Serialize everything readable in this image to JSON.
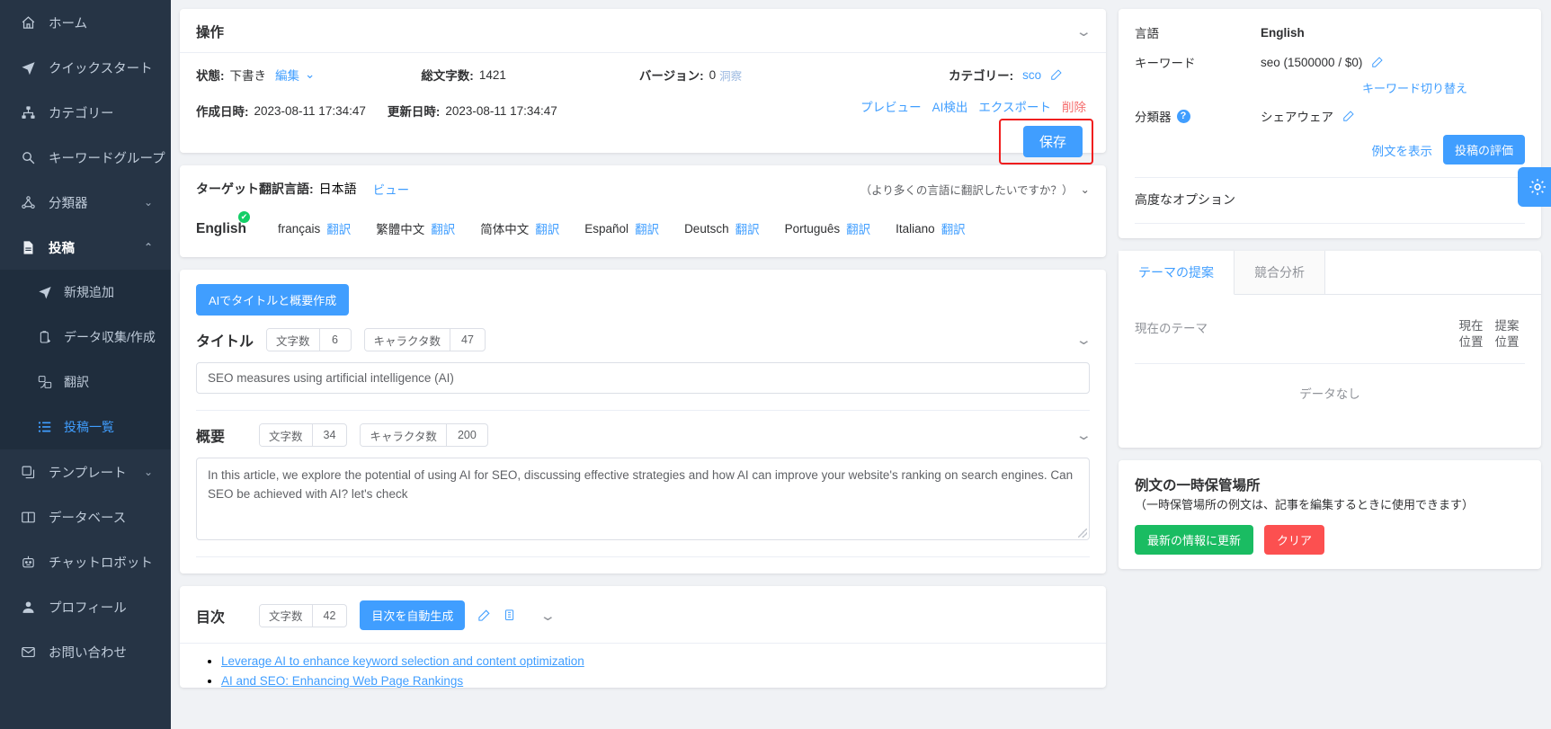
{
  "sidebar": {
    "items": [
      {
        "label": "ホーム",
        "icon": "home-icon",
        "caret": false
      },
      {
        "label": "クイックスタート",
        "icon": "rocket-icon",
        "caret": false
      },
      {
        "label": "カテゴリー",
        "icon": "sitemap-icon",
        "caret": false
      },
      {
        "label": "キーワードグループ",
        "icon": "search-icon",
        "caret": true
      },
      {
        "label": "分類器",
        "icon": "share-nodes-icon",
        "caret": true
      },
      {
        "label": "投稿",
        "icon": "document-icon",
        "caret": true,
        "expanded": true
      }
    ],
    "sub_items": [
      {
        "label": "新規追加",
        "icon": "send-icon",
        "active": false
      },
      {
        "label": "データ収集/作成",
        "icon": "clipboard-plus-icon",
        "active": false
      },
      {
        "label": "翻訳",
        "icon": "translate-icon",
        "active": false
      },
      {
        "label": "投稿一覧",
        "icon": "list-icon",
        "active": true
      }
    ],
    "items_after": [
      {
        "label": "テンプレート",
        "icon": "copy-icon",
        "caret": true
      },
      {
        "label": "データベース",
        "icon": "database-icon",
        "caret": false
      },
      {
        "label": "チャットロボット",
        "icon": "robot-icon",
        "caret": false
      },
      {
        "label": "プロフィール",
        "icon": "user-icon",
        "caret": false
      },
      {
        "label": "お問い合わせ",
        "icon": "mail-icon",
        "caret": false
      }
    ]
  },
  "operation": {
    "title": "操作",
    "status_label": "状態:",
    "status_value": "下書き",
    "edit_link": "編集",
    "chars_label": "総文字数:",
    "chars_value": "1421",
    "version_label": "バージョン:",
    "version_value": "0",
    "insight_link": "洞察",
    "category_label": "カテゴリー:",
    "category_value": "sco",
    "created_label": "作成日時:",
    "created_value": "2023-08-11 17:34:47",
    "updated_label": "更新日時:",
    "updated_value": "2023-08-11 17:34:47",
    "actions": [
      "プレビュー",
      "AI検出",
      "エクスポート"
    ],
    "delete_link": "削除",
    "save_label": "保存",
    "highlight_color": "#f01e1e"
  },
  "translation": {
    "target_label": "ターゲット翻訳言語:",
    "target_value": "日本語",
    "view_link": "ビュー",
    "more_text": "（より多くの言語に翻訳したいですか？）",
    "languages": [
      {
        "name": "English",
        "action": "",
        "primary": true,
        "checked": true
      },
      {
        "name": "français",
        "action": "翻訳"
      },
      {
        "name": "繁體中文",
        "action": "翻訳"
      },
      {
        "name": "简体中文",
        "action": "翻訳"
      },
      {
        "name": "Español",
        "action": "翻訳"
      },
      {
        "name": "Deutsch",
        "action": "翻訳"
      },
      {
        "name": "Português",
        "action": "翻訳"
      },
      {
        "name": "Italiano",
        "action": "翻訳"
      }
    ]
  },
  "editor": {
    "ai_button": "AIでタイトルと概要作成",
    "title_field": {
      "name": "タイトル",
      "count_label": "文字数",
      "count_value": "6",
      "char_label": "キャラクタ数",
      "char_value": "47",
      "value": "SEO measures using artificial intelligence (AI)"
    },
    "summary_field": {
      "name": "概要",
      "count_label": "文字数",
      "count_value": "34",
      "char_label": "キャラクタ数",
      "char_value": "200",
      "value": "In this article, we explore the potential of using AI for SEO, discussing effective strategies and how AI can improve your website's ranking on search engines. Can SEO be achieved with AI? let's check"
    }
  },
  "toc": {
    "name": "目次",
    "count_label": "文字数",
    "count_value": "42",
    "generate_button": "目次を自動生成",
    "items": [
      "Leverage AI to enhance keyword selection and content optimization",
      "AI and SEO: Enhancing Web Page Rankings"
    ]
  },
  "info_panel": {
    "language_label": "言語",
    "language_value": "English",
    "keyword_label": "キーワード",
    "keyword_value": "seo (1500000 / $0)",
    "keyword_switch_link": "キーワード切り替え",
    "classifier_label": "分類器",
    "classifier_value": "シェアウェア",
    "show_examples_link": "例文を表示",
    "evaluate_button": "投稿の評価",
    "advanced_options": "高度なオプション"
  },
  "theme_panel": {
    "tabs": [
      {
        "label": "テーマの提案",
        "active": true
      },
      {
        "label": "競合分析",
        "active": false
      }
    ],
    "current_theme_label": "現在のテーマ",
    "col_current": "現在\n位置",
    "col_current_l1": "現在",
    "col_current_l2": "位置",
    "col_suggest_l1": "提案",
    "col_suggest_l2": "位置",
    "no_data": "データなし"
  },
  "temp_panel": {
    "title": "例文の一時保管場所",
    "description": "（一時保管場所の例文は、記事を編集するときに使用できます）",
    "refresh_button": "最新の情報に更新",
    "clear_button": "クリア"
  },
  "colors": {
    "accent": "#409eff",
    "danger": "#f56c6c",
    "success": "#13ce66",
    "sidebar_bg": "#263445",
    "sidebar_sub_bg": "#1f2d3d"
  }
}
